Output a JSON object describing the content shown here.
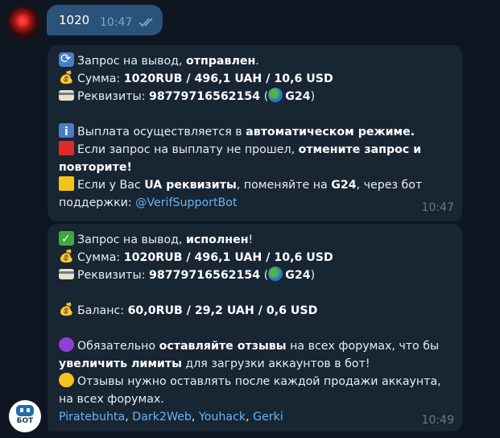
{
  "outgoing": {
    "text": "1020",
    "time": "10:47"
  },
  "msg1": {
    "l1": {
      "a": "Запрос на вывод, ",
      "b": "отправлен",
      "c": "."
    },
    "l2": {
      "a": "Сумма: ",
      "b": "1020RUB  / 496,1 UAH / 10,6 USD"
    },
    "l3": {
      "a": "Реквизиты: ",
      "b": "98779716562154",
      "c": " (",
      "d": "G24",
      "e": ")"
    },
    "l4": {
      "a": "Выплата осуществляется в ",
      "b": "автоматическом режиме."
    },
    "l5": {
      "a": "Если запрос на выплату не прошел, ",
      "b": "отмените запрос и"
    },
    "l6": {
      "b": "повторите!"
    },
    "l7": {
      "a": "Если у Вас ",
      "b1": "UA реквизиты",
      "c": ", поменяйте на ",
      "b2": "G24",
      "d": ", через бот"
    },
    "l8": {
      "a": "поддержки: ",
      "link": "@VerifSupportBot"
    },
    "time": "10:47"
  },
  "msg2": {
    "l1": {
      "a": "Запрос на вывод, ",
      "b": "исполнен",
      "c": "!"
    },
    "l2": {
      "a": "Сумма: ",
      "b": "1020RUB  / 496,1 UAH / 10,6 USD"
    },
    "l3": {
      "a": "Реквизиты: ",
      "b": "98779716562154",
      "c": " (",
      "d": "G24",
      "e": ")"
    },
    "l4": {
      "a": "Баланс: ",
      "b": "60,0RUB  / 29,2 UAH / 0,6 USD"
    },
    "l5": {
      "a": "Обязательно ",
      "b": "оставляйте отзывы",
      "c": " на всех форумах, что бы"
    },
    "l6": {
      "b": "увеличить лимиты",
      "c": " для загрузки аккаунтов в бот!"
    },
    "l7": {
      "a": "Отзывы нужно оставлять после каждой продажи аккаунта,"
    },
    "l8": {
      "a": "на всех форумах."
    },
    "links": [
      "Piratebuhta",
      "Dark2Web",
      "Youhack",
      "Gerki"
    ],
    "sep": ", ",
    "time": "10:49"
  },
  "bot_avatar": {
    "label": "БОТ"
  },
  "colors": {
    "background": "#0e1621",
    "outgoing_bubble": "#2b5278",
    "incoming_bubble": "#182533",
    "link": "#6ab3f3",
    "time": "#6c7883"
  }
}
